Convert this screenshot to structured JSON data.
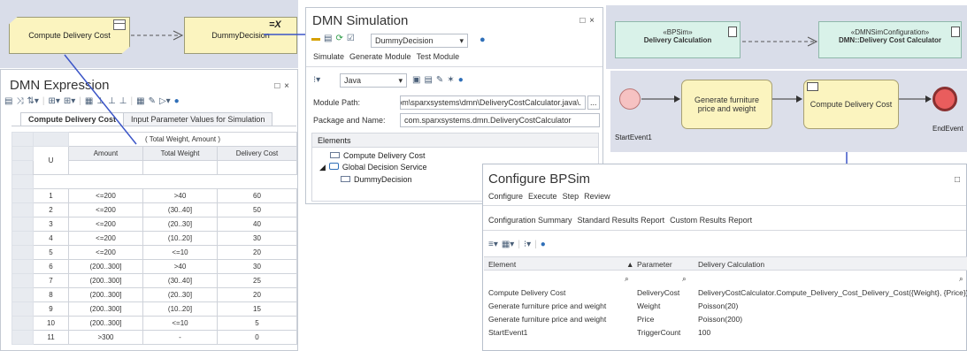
{
  "diagram_left": {
    "compute_label": "Compute Delivery Cost",
    "dummy_label": "DummyDecision",
    "eq_x": "=X"
  },
  "dmn_expression": {
    "title": "DMN Expression",
    "window_controls": "□ ×",
    "tabs": [
      "Compute Delivery Cost",
      "Input Parameter Values for Simulation"
    ],
    "merged_header": "( Total Weight, Amount )",
    "hit_policy": "U",
    "columns": [
      "Amount",
      "Total Weight",
      "Delivery Cost"
    ],
    "rows": [
      [
        "1",
        "<=200",
        ">40",
        "60"
      ],
      [
        "2",
        "<=200",
        "(30..40]",
        "50"
      ],
      [
        "3",
        "<=200",
        "(20..30]",
        "40"
      ],
      [
        "4",
        "<=200",
        "(10..20]",
        "30"
      ],
      [
        "5",
        "<=200",
        "<=10",
        "20"
      ],
      [
        "6",
        "(200..300]",
        ">40",
        "30"
      ],
      [
        "7",
        "(200..300]",
        "(30..40]",
        "25"
      ],
      [
        "8",
        "(200..300]",
        "(20..30]",
        "20"
      ],
      [
        "9",
        "(200..300]",
        "(10..20]",
        "15"
      ],
      [
        "10",
        "(200..300]",
        "<=10",
        "5"
      ],
      [
        "11",
        ">300",
        "-",
        "0"
      ]
    ]
  },
  "dmn_simulation": {
    "title": "DMN Simulation",
    "window_controls": "□ ×",
    "decision_select": "DummyDecision",
    "menu": [
      "Simulate",
      "Generate Module",
      "Test Module"
    ],
    "language": "Java",
    "module_path_label": "Module Path:",
    "module_path_value": ".\\com\\sparxsystems\\dmn\\DeliveryCostCalculator.java",
    "browse": "...",
    "package_label": "Package and Name:",
    "package_value": "com.sparxsystems.dmn.DeliveryCostCalculator",
    "elements_header": "Elements",
    "elements": {
      "compute": "Compute Delivery Cost",
      "service": "Global Decision Service",
      "dummy": "DummyDecision"
    }
  },
  "diagram_right": {
    "bpsim_stereo": "«BPSim»",
    "bpsim_name": "Delivery Calculation",
    "config_stereo": "«DMNSimConfiguration»",
    "config_name": "DMN::Delivery Cost Calculator",
    "start_event": "StartEvent1",
    "task_generate": "Generate furniture price and weight",
    "task_compute": "Compute Delivery Cost",
    "end_event": "EndEvent"
  },
  "bpsim": {
    "title": "Configure BPSim",
    "window_controls": "□",
    "menu": [
      "Configure",
      "Execute",
      "Step",
      "Review"
    ],
    "sub_tabs": [
      "Configuration Summary",
      "Standard Results Report",
      "Custom Results Report"
    ],
    "columns": [
      "Element",
      "Parameter",
      "Delivery Calculation"
    ],
    "rows": [
      [
        "Compute Delivery Cost",
        "DeliveryCost",
        "DeliveryCostCalculator.Compute_Delivery_Cost_Delivery_Cost({Weight}, {Price})"
      ],
      [
        "Generate furniture price and weight",
        "Weight",
        "Poisson(20)"
      ],
      [
        "Generate furniture price and weight",
        "Price",
        "Poisson(200)"
      ],
      [
        "StartEvent1",
        "TriggerCount",
        "100"
      ]
    ]
  },
  "colors": {
    "decision_fill": "#fbf4bf",
    "artifact_fill": "#d9f2e9",
    "canvas_fill": "#d9dde9",
    "connector_blue": "#3b55c7",
    "start_event": "#f6c2c2",
    "end_event": "#e95d5d"
  }
}
